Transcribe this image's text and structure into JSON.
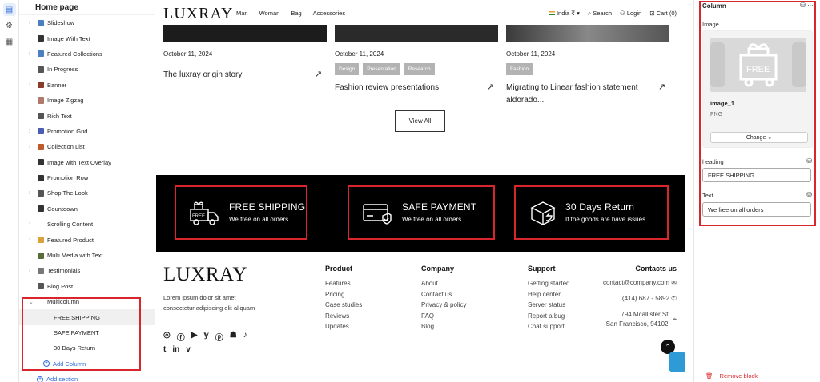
{
  "sidebar": {
    "title": "Home page",
    "items": [
      {
        "label": "Slideshow",
        "chevron": true,
        "color": "#4a7fc1"
      },
      {
        "label": "Image With Text",
        "chevron": false,
        "color": "#333"
      },
      {
        "label": "Featured Collections",
        "chevron": true,
        "color": "#4a7fc1"
      },
      {
        "label": "In Progress",
        "chevron": false,
        "color": "#555"
      },
      {
        "label": "Banner",
        "chevron": true,
        "color": "#8a3b2a"
      },
      {
        "label": "Image Zigzag",
        "chevron": false,
        "color": "#b07a6a"
      },
      {
        "label": "Rich Text",
        "chevron": false,
        "color": "#555"
      },
      {
        "label": "Promotion Grid",
        "chevron": true,
        "color": "#4a5fb3"
      },
      {
        "label": "Collection List",
        "chevron": true,
        "color": "#c05a2a"
      },
      {
        "label": "Image with Text Overlay",
        "chevron": false,
        "color": "#333"
      },
      {
        "label": "Promotion Row",
        "chevron": false,
        "color": "#333"
      },
      {
        "label": "Shop The Look",
        "chevron": true,
        "color": "#555"
      },
      {
        "label": "Countdown",
        "chevron": false,
        "color": "#333"
      },
      {
        "label": "Scrolling Content",
        "chevron": true,
        "color": "#fff"
      },
      {
        "label": "Featured Product",
        "chevron": true,
        "color": "#d9a23a"
      },
      {
        "label": "Multi Media with Text",
        "chevron": false,
        "color": "#5a6a3a"
      },
      {
        "label": "Testimonials",
        "chevron": true,
        "color": "#777"
      },
      {
        "label": "Blog Post",
        "chevron": false,
        "color": "#555"
      }
    ],
    "multicolumn": {
      "label": "Multicolumn",
      "children": [
        "FREE SHIPPING",
        "SAFE PAYMENT",
        "30 Days Return"
      ],
      "add_column": "Add Column"
    },
    "add_section": "Add section"
  },
  "nav": {
    "logo": "LUXRAY",
    "links": [
      "Man",
      "Woman",
      "Bag",
      "Accessories"
    ],
    "country": "India ₹",
    "search": "Search",
    "login": "Login",
    "cart": "Cart (0)"
  },
  "blogs": [
    {
      "date": "October 11, 2024",
      "tags": [],
      "title": "The luxray origin story"
    },
    {
      "date": "October 11, 2024",
      "tags": [
        "Design",
        "Presentation",
        "Research"
      ],
      "title": "Fashion review presentations"
    },
    {
      "date": "October 11, 2024",
      "tags": [
        "Fashion"
      ],
      "title": "Migrating to Linear fashion statement aldorado..."
    }
  ],
  "view_all": "View All",
  "features": [
    {
      "title": "FREE SHIPPING",
      "subtitle": "We free on all orders",
      "icon": "truck-gift-icon"
    },
    {
      "title": "SAFE PAYMENT",
      "subtitle": "We free on all orders",
      "icon": "credit-card-icon"
    },
    {
      "title": "30 Days Return",
      "subtitle": "If the goods are have issues",
      "icon": "return-box-icon"
    }
  ],
  "footer": {
    "logo": "LUXRAY",
    "description": "Lorem ipsum dolor sit amet consectetur adipiscing elit aliquam",
    "columns": [
      {
        "title": "Product",
        "links": [
          "Features",
          "Pricing",
          "Case studies",
          "Reviews",
          "Updates"
        ]
      },
      {
        "title": "Company",
        "links": [
          "About",
          "Contact us",
          "Privacy & policy",
          "FAQ",
          "Blog"
        ]
      },
      {
        "title": "Support",
        "links": [
          "Getting started",
          "Help center",
          "Server status",
          "Report a bug",
          "Chat support"
        ]
      }
    ],
    "contacts": {
      "title": "Contacts us",
      "email": "contact@company.com",
      "phone": "(414) 687 - 5892",
      "address1": "794 Mcallister St",
      "address2": "San Francisco, 94102"
    }
  },
  "panel": {
    "title": "Column",
    "image_label": "Image",
    "placeholder_text": "FREE",
    "file_name": "image_1",
    "file_type": "PNG",
    "change_label": "Change",
    "heading_label": "heading",
    "heading_value": "FREE SHIPPING",
    "text_label": "Text",
    "text_value": "We free on all orders",
    "remove_label": "Remove block"
  }
}
